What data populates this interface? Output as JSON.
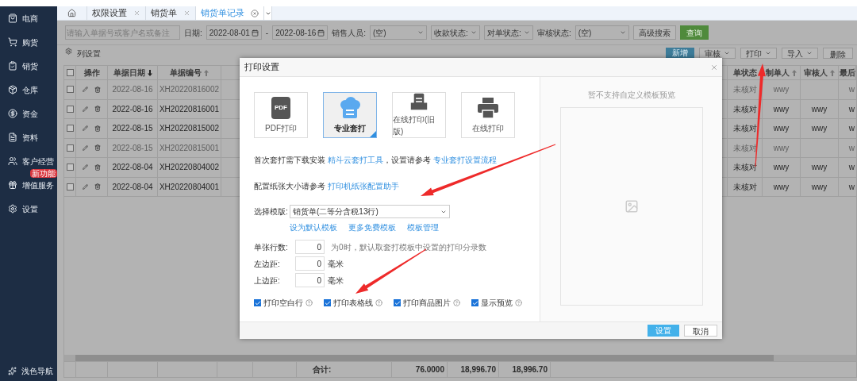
{
  "sidebar": {
    "items": [
      {
        "label": "电商"
      },
      {
        "label": "购货"
      },
      {
        "label": "销货"
      },
      {
        "label": "仓库"
      },
      {
        "label": "资金"
      },
      {
        "label": "资料"
      },
      {
        "label": "客户经营"
      },
      {
        "label": "增值服务",
        "badge": "新功能"
      },
      {
        "label": "设置"
      }
    ],
    "footer": "浅色导航"
  },
  "tabs": [
    {
      "label": "权限设置",
      "selected": false
    },
    {
      "label": "销货单",
      "selected": false
    },
    {
      "label": "销货单记录",
      "selected": true
    }
  ],
  "filters": {
    "search_placeholder": "请输入单据号或客户名或备注",
    "date_label": "日期:",
    "date_from": "2022-08-01",
    "date_separator": "-",
    "date_to": "2022-08-16",
    "salesperson_label": "销售人员:",
    "salesperson_value": "(空)",
    "payment_status": "收款状态:",
    "reconcile_status": "对单状态:",
    "audit_label": "审核状态:",
    "audit_value": "(空)",
    "advanced_search": "高级搜索",
    "query": "查询"
  },
  "toolbar": {
    "column_settings": "列设置",
    "buttons": [
      {
        "label": "新增",
        "kind": "primary"
      },
      {
        "label": "审核",
        "kind": "dropdown"
      },
      {
        "label": "打印",
        "kind": "dropdown"
      },
      {
        "label": "导入",
        "kind": "dropdown"
      },
      {
        "label": "删除",
        "kind": "plain"
      }
    ]
  },
  "table": {
    "select_all_checked": false,
    "columns_left": [
      {
        "label": "操作"
      },
      {
        "label": "单据日期",
        "sort_active": true,
        "descending": true
      },
      {
        "label": "单据编号",
        "sort_active": false,
        "descending": false
      }
    ],
    "columns_right": [
      {
        "label": "单状态"
      },
      {
        "label": "制单人",
        "sort_active": false,
        "descending": false
      },
      {
        "label": "审核人",
        "sort_active": false,
        "descending": false
      },
      {
        "label": "最后"
      }
    ],
    "rows": [
      {
        "checked": false,
        "date": "2022-08-16",
        "number": "XH20220816002",
        "status": "未核对",
        "creator": "wwy",
        "last": "w",
        "dimmed": true
      },
      {
        "checked": false,
        "date": "2022-08-16",
        "number": "XH20220816001",
        "status": "未核对",
        "creator": "wwy",
        "auditor": "wwy",
        "last": "w",
        "dimmed": false
      },
      {
        "checked": false,
        "date": "2022-08-15",
        "number": "XH20220815002",
        "status": "未核对",
        "creator": "wwy",
        "auditor": "wwy",
        "last": "w",
        "dimmed": false
      },
      {
        "checked": false,
        "date": "2022-08-15",
        "number": "XH20220815001",
        "status": "未核对",
        "creator": "wwy",
        "last": "w",
        "dimmed": true
      },
      {
        "checked": false,
        "date": "2022-08-04",
        "number": "XH20220804002",
        "status": "未核对",
        "creator": "wwy",
        "auditor": "wwy",
        "last": "w",
        "dimmed": false
      },
      {
        "checked": false,
        "date": "2022-08-04",
        "number": "XH20220804001",
        "status": "未核对",
        "creator": "wwy",
        "auditor": "wwy",
        "last": "w",
        "dimmed": false
      }
    ],
    "totals": {
      "label": "合计:",
      "quantity": "76.0000",
      "amount_1": "18,996.70",
      "amount_2": "18,996.70"
    }
  },
  "dialog": {
    "title": "打印设置",
    "modes": [
      {
        "label": "PDF打印",
        "kind": "pdf",
        "icon_text": "PDF",
        "selected": false
      },
      {
        "label": "专业套打",
        "kind": "cloud",
        "selected": true
      },
      {
        "label": "在线打印(旧版)",
        "kind": "tray",
        "selected": false
      },
      {
        "label": "在线打印",
        "kind": "printer",
        "selected": false
      }
    ],
    "notes": [
      {
        "text": "首次套打需下载安装",
        "link": "精斗云套打工具",
        "text_2": "，设置请参考",
        "link_2": "专业套打设置流程"
      },
      {
        "text": "配置纸张大小请参考",
        "link": "打印机纸张配置助手"
      }
    ],
    "template": {
      "label": "选择模版:",
      "value": "销货单(二等分含税13行)",
      "links": [
        "设为默认模板",
        "更多免费模板",
        "模板管理"
      ]
    },
    "fields": [
      {
        "label": "单张行数:",
        "value": "0",
        "hint": "为0时，默认取套打模板中设置的打印分录数"
      },
      {
        "label": "左边距:",
        "value": "0",
        "unit": "毫米"
      },
      {
        "label": "上边距:",
        "value": "0",
        "unit": "毫米"
      }
    ],
    "options": [
      {
        "label": "打印空白行",
        "checked": true
      },
      {
        "label": "打印表格线",
        "checked": true
      },
      {
        "label": "打印商品图片",
        "checked": true
      },
      {
        "label": "显示预览",
        "checked": true
      }
    ],
    "preview_message": "暂不支持自定义模板预览",
    "buttons": [
      {
        "label": "设置",
        "kind": "primary"
      },
      {
        "label": "取消",
        "kind": "plain"
      }
    ]
  }
}
